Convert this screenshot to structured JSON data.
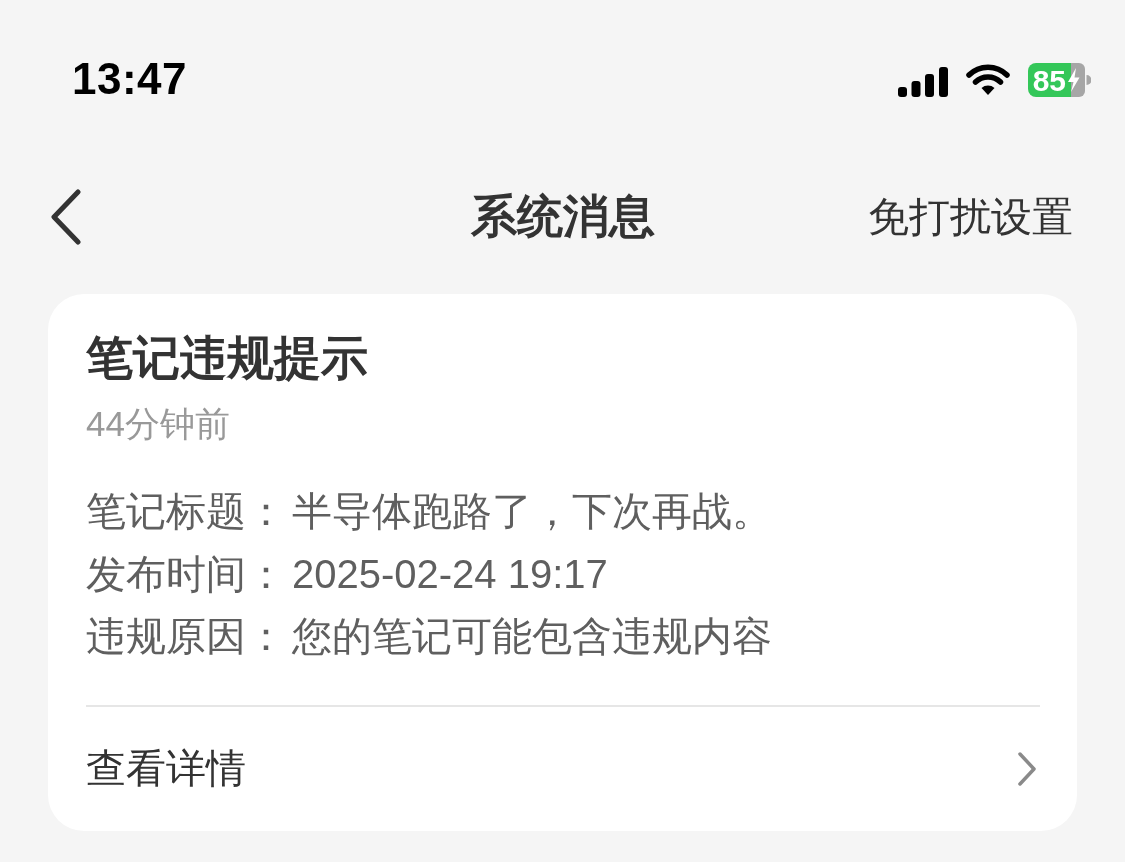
{
  "status_bar": {
    "time": "13:47",
    "battery": "85"
  },
  "nav": {
    "title": "系统消息",
    "action": "免打扰设置"
  },
  "card": {
    "title": "笔记违规提示",
    "time": "44分钟前",
    "details": [
      {
        "label": "笔记标题：",
        "value": "半导体跑路了，下次再战。"
      },
      {
        "label": "发布时间：",
        "value": "2025-02-24 19:17"
      },
      {
        "label": "违规原因：",
        "value": "您的笔记可能包含违规内容"
      }
    ],
    "link": "查看详情"
  }
}
